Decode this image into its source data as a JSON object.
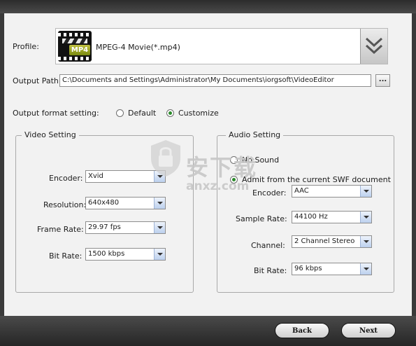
{
  "profile": {
    "label": "Profile:",
    "value": "MPEG-4 Movie(*.mp4)",
    "icon_badge": "MP4",
    "icon": "film-clapper-icon",
    "dropdown_icon": "double-chevron-down-icon"
  },
  "output_path": {
    "label": "Output Path:",
    "value": "C:\\Documents and Settings\\Administrator\\My Documents\\iorgsoft\\VideoEditor",
    "browse_label": "..."
  },
  "format_setting": {
    "label": "Output format setting:",
    "options": [
      {
        "label": "Default",
        "selected": false
      },
      {
        "label": "Customize",
        "selected": true
      }
    ]
  },
  "video_setting": {
    "title": "Video Setting",
    "fields": [
      {
        "label": "Encoder:",
        "value": "Xvid"
      },
      {
        "label": "Resolution:",
        "value": "640x480"
      },
      {
        "label": "Frame Rate:",
        "value": "29.97 fps"
      },
      {
        "label": "Bit Rate:",
        "value": "1500 kbps"
      }
    ]
  },
  "audio_setting": {
    "title": "Audio Setting",
    "options": [
      {
        "label": "No Sound",
        "selected": false
      },
      {
        "label": "Admit from the current SWF document",
        "selected": true
      }
    ],
    "fields": [
      {
        "label": "Encoder:",
        "value": "AAC"
      },
      {
        "label": "Sample Rate:",
        "value": "44100 Hz"
      },
      {
        "label": "Channel:",
        "value": "2 Channel Stereo"
      },
      {
        "label": "Bit Rate:",
        "value": "96 kbps"
      }
    ]
  },
  "watermark": {
    "text": "安下载",
    "subtext": "anxz.com"
  },
  "footer": {
    "back_label": "Back",
    "next_label": "Next"
  },
  "colors": {
    "radio_selected": "#2a8a2a",
    "frame": "#3a3a3a",
    "panel": "#f2f2f2"
  }
}
